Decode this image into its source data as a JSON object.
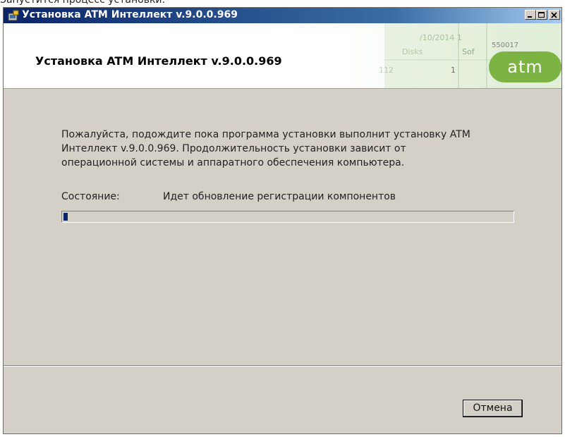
{
  "page_caption": "Запустится процесс установки:",
  "window": {
    "title": "Установка ATM Интеллект v.9.0.0.969",
    "controls": [
      "minimize",
      "maximize",
      "close"
    ]
  },
  "banner": {
    "title": "Установка ATM Интеллект v.9.0.0.969",
    "logo_text": "atm",
    "background_fragments": [
      "/10/2014 1",
      "550017",
      "Disks",
      "Sof",
      "112",
      "1"
    ],
    "logo_color": "#7cb342"
  },
  "main": {
    "message_lines": [
      "Пожалуйста, подождите пока программа установки выполнит установку ATM",
      "Интеллект v.9.0.0.969. Продолжительность установки зависит от",
      "операционной системы и аппаратного обеспечения компьютера."
    ],
    "status_label": "Состояние:",
    "status_value": "Идет обновление регистрации компонентов",
    "progress_percent": 1
  },
  "footer": {
    "cancel_label": "Отмена"
  },
  "colors": {
    "title_gradient_start": "#0a246a",
    "title_gradient_end": "#a6caf0",
    "dialog_bg": "#d4d0c8",
    "progress_fill": "#0a246a"
  }
}
